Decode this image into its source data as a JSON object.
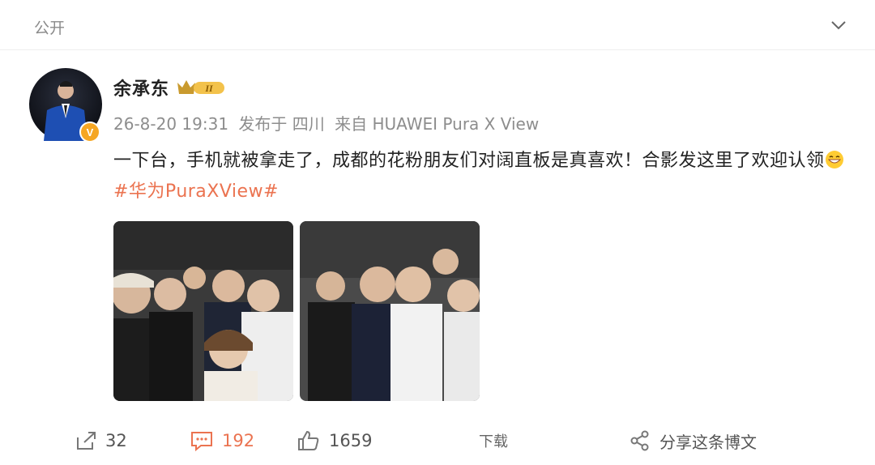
{
  "header": {
    "visibility": "公开"
  },
  "post": {
    "author": "余承东",
    "member_level": "II",
    "verified_badge": "V",
    "timestamp": "26-8-20 19:31",
    "location": "发布于 四川",
    "source": "来自 HUAWEI Pura X View",
    "text": "一下台，手机就被拿走了，成都的花粉朋友们对阔直板是真喜欢！合影发这里了欢迎认领",
    "topic": "#华为PuraXView#"
  },
  "actions": {
    "forward_count": "32",
    "comment_count": "192",
    "like_count": "1659",
    "download_label": "下载",
    "share_label": "分享这条博文"
  },
  "colors": {
    "accent": "#eb7350",
    "badge_gold": "#f5a623"
  }
}
